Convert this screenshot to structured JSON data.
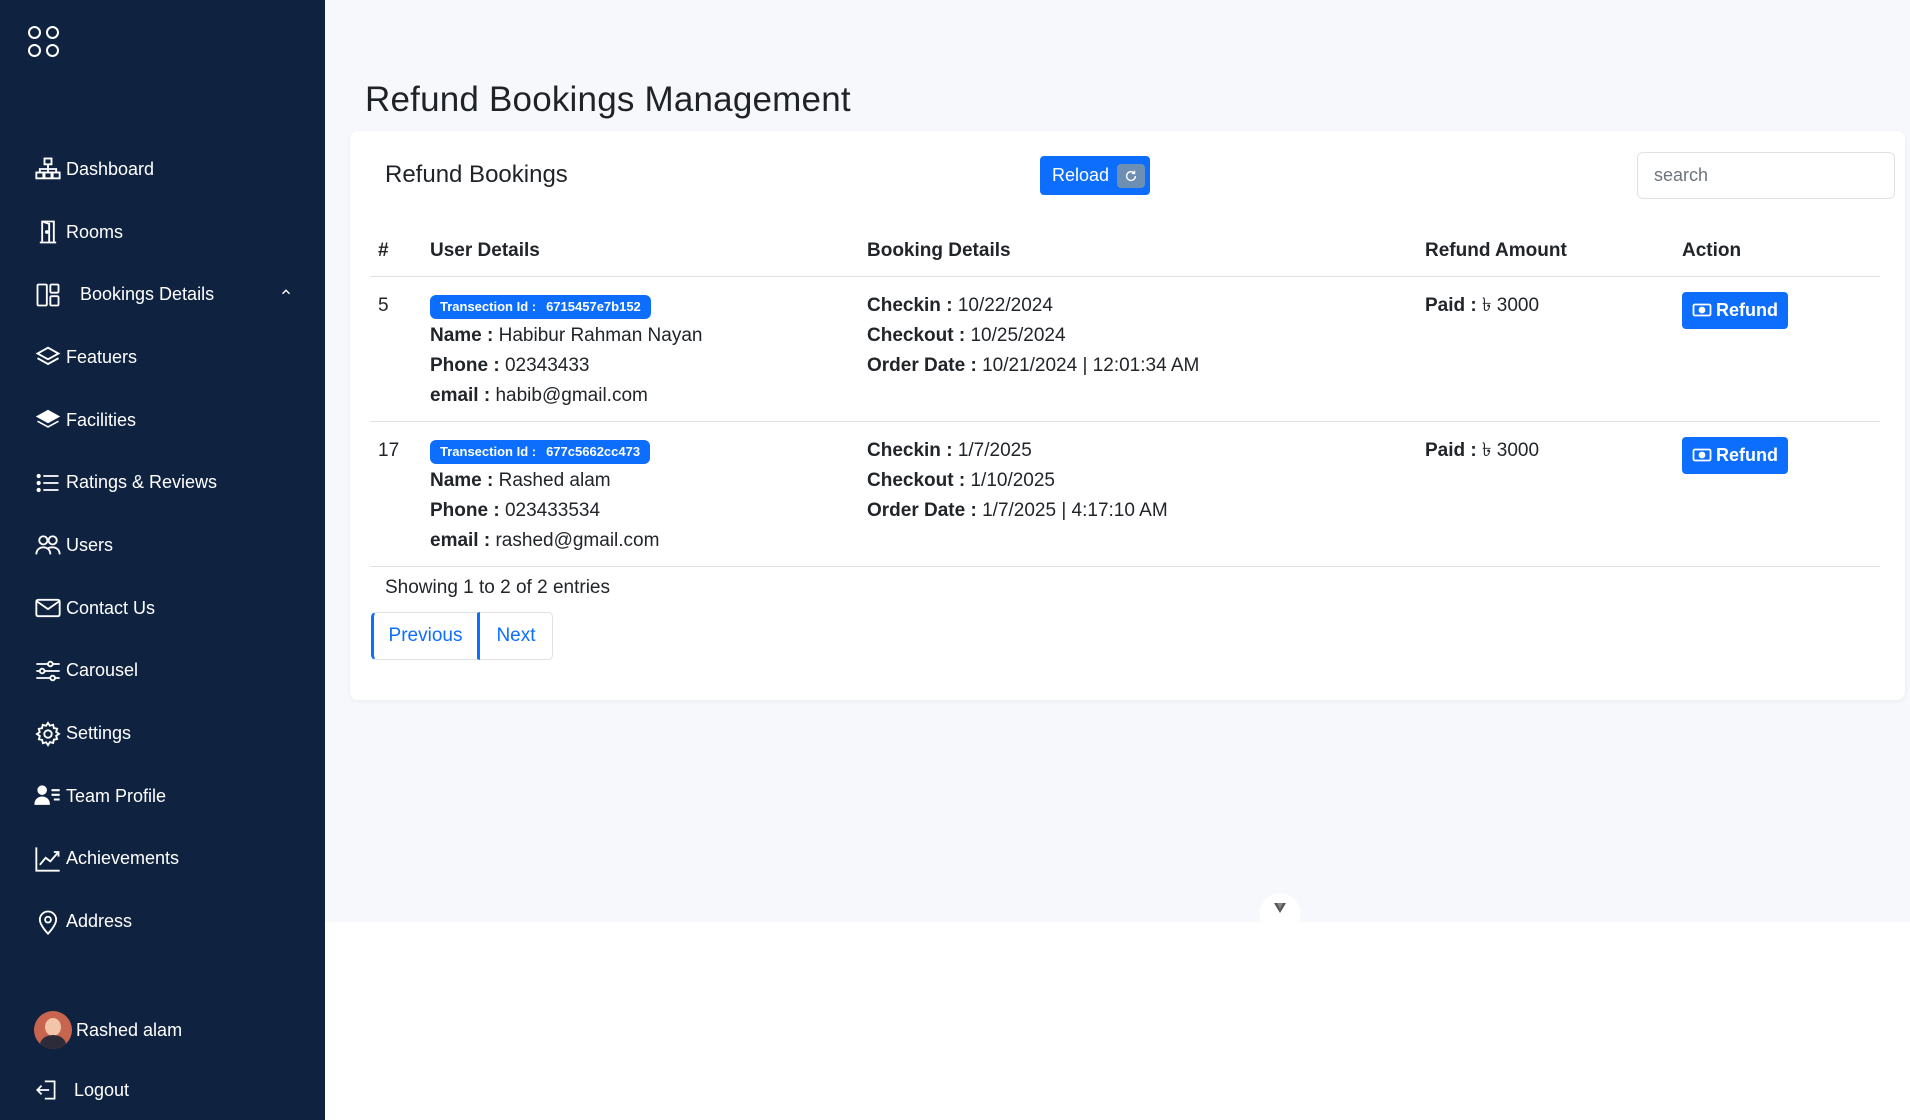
{
  "sidebar": {
    "items": [
      {
        "label": "Dashboard",
        "icon": "sitemap-icon"
      },
      {
        "label": "Rooms",
        "icon": "door-icon"
      },
      {
        "label": "Bookings Details",
        "icon": "layout-icon"
      },
      {
        "label": "Featuers",
        "icon": "layers-icon"
      },
      {
        "label": "Facilities",
        "icon": "layers-fill-icon"
      },
      {
        "label": "Ratings & Reviews",
        "icon": "list-icon"
      },
      {
        "label": "Users",
        "icon": "people-icon"
      },
      {
        "label": "Contact Us",
        "icon": "envelope-icon"
      },
      {
        "label": "Carousel",
        "icon": "sliders-icon"
      },
      {
        "label": "Settings",
        "icon": "gear-icon"
      },
      {
        "label": "Team Profile",
        "icon": "person-lines-icon"
      },
      {
        "label": "Achievements",
        "icon": "graph-up-icon"
      },
      {
        "label": "Address",
        "icon": "geo-icon"
      }
    ],
    "user_name": "Rashed alam",
    "logout_label": "Logout"
  },
  "page": {
    "title": "Refund Bookings Management"
  },
  "card": {
    "title": "Refund Bookings",
    "reload_label": "Reload",
    "search_placeholder": "search"
  },
  "table": {
    "headers": [
      "#",
      "User Details",
      "Booking Details",
      "Refund Amount",
      "Action"
    ],
    "rows": [
      {
        "num": "5",
        "tx_label": "Transection Id :",
        "tx_id": "6715457e7b152",
        "name_label": "Name :",
        "name": "Habibur Rahman Nayan",
        "phone_label": "Phone :",
        "phone": "02343433",
        "email_label": "email :",
        "email": "habib@gmail.com",
        "checkin_label": "Checkin :",
        "checkin": "10/22/2024",
        "checkout_label": "Checkout :",
        "checkout": "10/25/2024",
        "order_label": "Order Date :",
        "order_date": "10/21/2024 | 12:01:34 AM",
        "paid_label": "Paid :",
        "paid": "৳ 3000",
        "action_label": "Refund"
      },
      {
        "num": "17",
        "tx_label": "Transection Id :",
        "tx_id": "677c5662cc473",
        "name_label": "Name :",
        "name": "Rashed alam",
        "phone_label": "Phone :",
        "phone": "023433534",
        "email_label": "email :",
        "email": "rashed@gmail.com",
        "checkin_label": "Checkin :",
        "checkin": "1/7/2025",
        "checkout_label": "Checkout :",
        "checkout": "1/10/2025",
        "order_label": "Order Date :",
        "order_date": "1/7/2025 | 4:17:10 AM",
        "paid_label": "Paid :",
        "paid": "৳ 3000",
        "action_label": "Refund"
      }
    ]
  },
  "pagination": {
    "summary": "Showing 1 to 2 of 2 entries",
    "previous": "Previous",
    "next": "Next"
  },
  "colors": {
    "sidebar_bg": "#0f2340",
    "primary": "#0d6efd",
    "main_bg": "#f6f8fb"
  }
}
